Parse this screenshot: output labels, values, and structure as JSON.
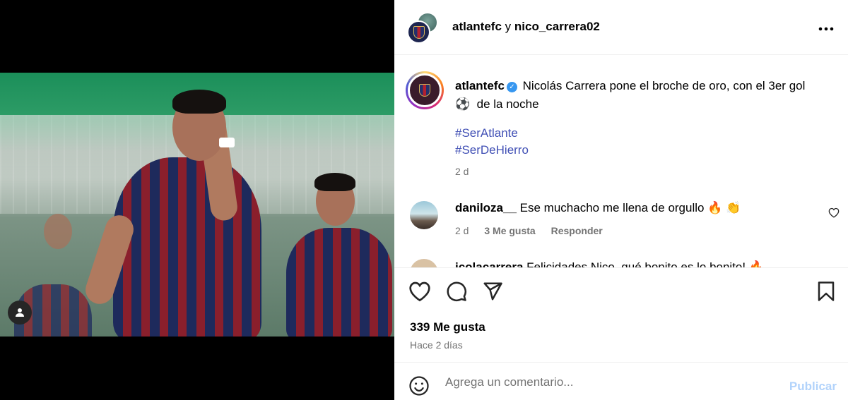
{
  "post": {
    "header": {
      "user1": "atlantefc",
      "conjunction": "y",
      "user2": "nico_carrera02",
      "more_icon": "more-horizontal-icon"
    },
    "caption": {
      "username": "atlantefc",
      "text": "Nicolás Carrera pone el broche de oro, con el 3er gol",
      "text2": "de la noche",
      "emoji": "⚽",
      "hashtags": [
        "#SerAtlante",
        "#SerDeHierro"
      ],
      "time": "2 d"
    },
    "comments": [
      {
        "username": "daniloza__",
        "text": "Ese muchacho me llena de orgullo",
        "emojis": "🔥 👏",
        "time": "2 d",
        "likes": "3 Me gusta",
        "reply": "Responder"
      },
      {
        "username": "jcolacarrera",
        "text": "Felicidades Nico, qué bonito es lo bonito!",
        "emojis": "🔥"
      }
    ],
    "likes": "339 Me gusta",
    "posted": "Hace 2 días",
    "composer": {
      "placeholder": "Agrega un comentario...",
      "publish": "Publicar"
    }
  },
  "colors": {
    "link_blue": "#4150b5",
    "verified_blue": "#3797f0",
    "publish_disabled": "#b2d3fb",
    "muted": "#737373"
  }
}
